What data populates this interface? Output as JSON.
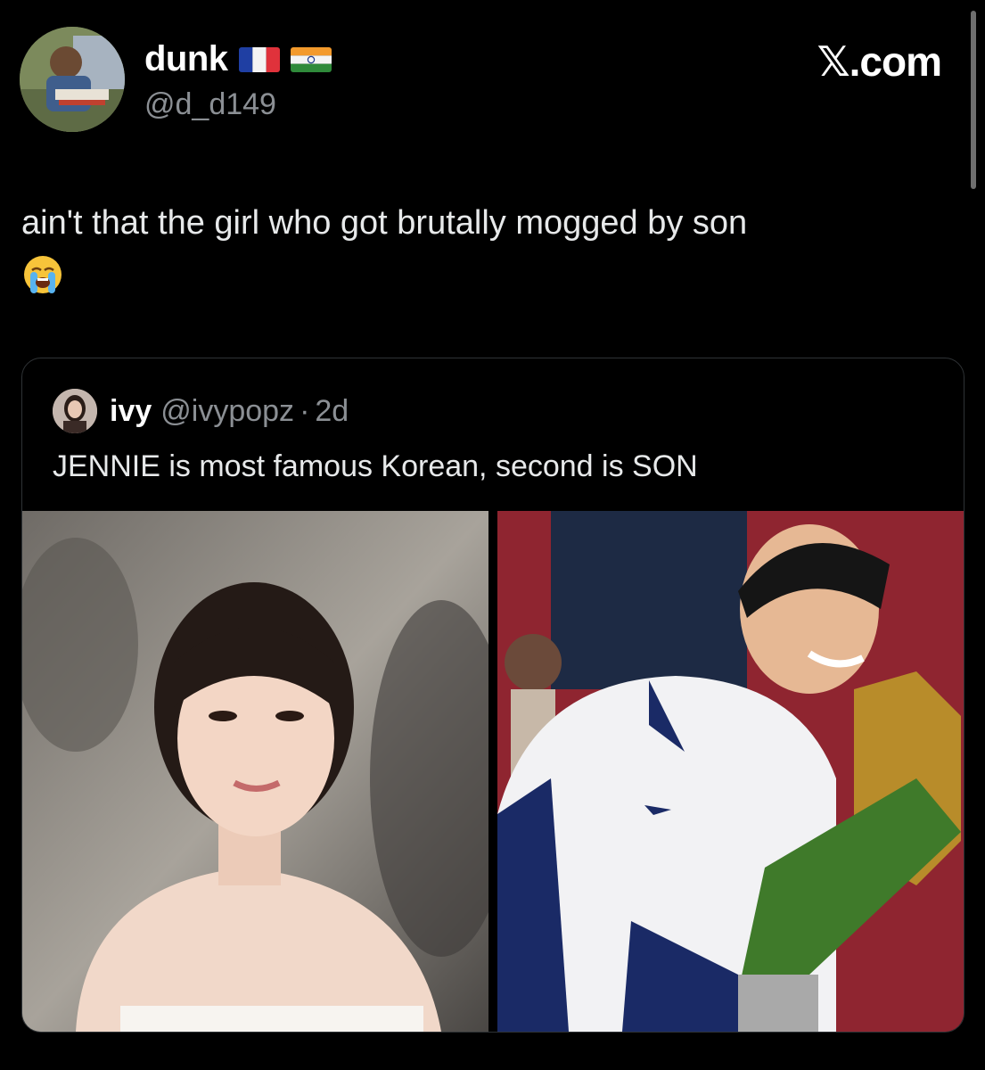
{
  "author": {
    "display_name": "dunk",
    "handle": "@d_d149",
    "flags": [
      "flag-france-icon",
      "flag-india-icon"
    ]
  },
  "brand": {
    "label": "𝕏.com"
  },
  "tweet": {
    "text": "ain't that the girl who got brutally mogged by son",
    "emoji": "loudly-crying-face-icon"
  },
  "quote": {
    "name": "ivy",
    "handle": "@ivypopz",
    "separator": "·",
    "time": "2d",
    "text": "JENNIE is most famous Korean, second is SON",
    "photos": [
      "woman-portrait",
      "footballer-with-trophy"
    ]
  },
  "colors": {
    "background": "#000000",
    "text": "#e7e9ea",
    "muted": "#8b8f94",
    "border": "#2f3336"
  }
}
